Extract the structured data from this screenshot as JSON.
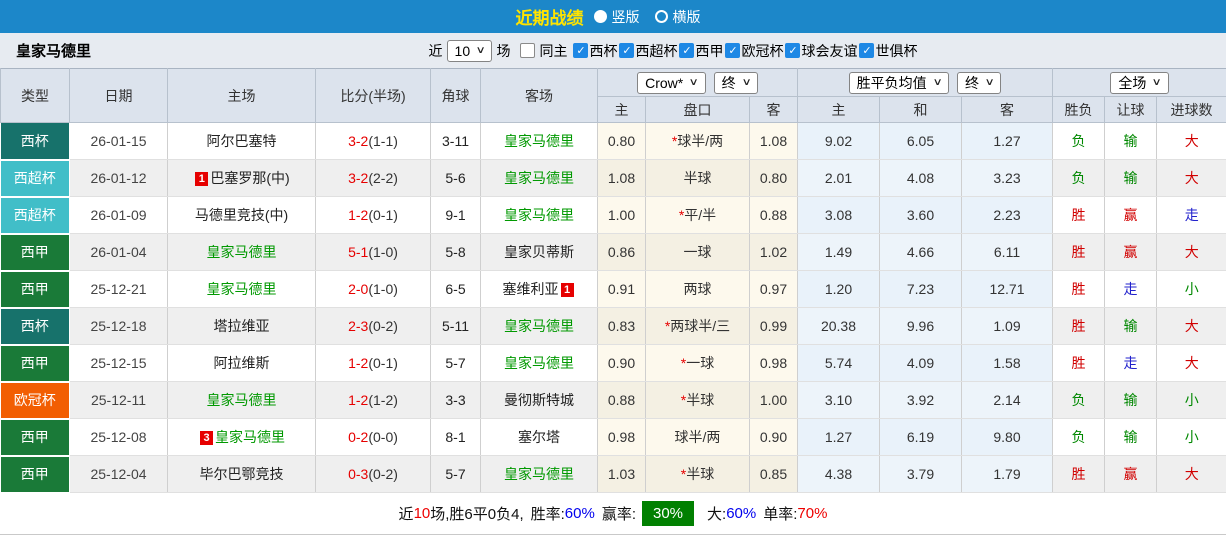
{
  "colors": {
    "topbar": "#1C87C9",
    "title": "#FFE400",
    "team_green": "#009900",
    "score_red": "#E60000",
    "badge_red": "#E60000",
    "res_red": "#D10000",
    "res_green": "#008800",
    "res_blue": "#2222CC",
    "rate_blue": "#0000EE",
    "rate_red": "#EE0000",
    "rate_green_bg": "#018001"
  },
  "titlebar": {
    "title": "近期战绩",
    "radio_vertical": "竖版",
    "radio_horizontal": "横版"
  },
  "filterbar": {
    "team": "皇家马德里",
    "recent_label": "近",
    "recent_value": "10",
    "recent_suffix": "场",
    "same_home_label": "同主",
    "competitions": [
      "西杯",
      "西超杯",
      "西甲",
      "欧冠杯",
      "球会友谊",
      "世俱杯"
    ]
  },
  "header": {
    "cols": [
      "类型",
      "日期",
      "主场",
      "比分(半场)",
      "角球",
      "客场"
    ],
    "odds_select": "Crow*",
    "odds_final_select": "终",
    "avg_select": "胜平负均值",
    "avg_final_select": "终",
    "scope_select": "全场",
    "sub": [
      "主",
      "盘口",
      "客",
      "主",
      "和",
      "客",
      "胜负",
      "让球",
      "进球数"
    ]
  },
  "rows": [
    {
      "type": "西杯",
      "type_color": "#17726B",
      "date": "26-01-15",
      "home": "阿尔巴塞特",
      "home_green": false,
      "home_badge": "",
      "score": "3-2",
      "half": "(1-1)",
      "corner": "3-11",
      "away": "皇家马德里",
      "away_green": true,
      "away_badge": "",
      "odds_home": "0.80",
      "hcp_star": "*",
      "hcp": "球半/两",
      "odds_away": "1.08",
      "avg_home": "9.02",
      "avg_draw": "6.05",
      "avg_away": "1.27",
      "res_wdl": "负",
      "wdl_color": "green",
      "res_hcp": "输",
      "hcp_color": "green",
      "res_goal": "大",
      "goal_color": "red"
    },
    {
      "type": "西超杯",
      "type_color": "#41BEC8",
      "date": "26-01-12",
      "home": "巴塞罗那(中)",
      "home_green": false,
      "home_badge": "1",
      "score": "3-2",
      "half": "(2-2)",
      "corner": "5-6",
      "away": "皇家马德里",
      "away_green": true,
      "away_badge": "",
      "odds_home": "1.08",
      "hcp_star": "",
      "hcp": "半球",
      "odds_away": "0.80",
      "avg_home": "2.01",
      "avg_draw": "4.08",
      "avg_away": "3.23",
      "res_wdl": "负",
      "wdl_color": "green",
      "res_hcp": "输",
      "hcp_color": "green",
      "res_goal": "大",
      "goal_color": "red"
    },
    {
      "type": "西超杯",
      "type_color": "#41BEC8",
      "date": "26-01-09",
      "home": "马德里竞技(中)",
      "home_green": false,
      "home_badge": "",
      "score": "1-2",
      "half": "(0-1)",
      "corner": "9-1",
      "away": "皇家马德里",
      "away_green": true,
      "away_badge": "",
      "odds_home": "1.00",
      "hcp_star": "*",
      "hcp": "平/半",
      "odds_away": "0.88",
      "avg_home": "3.08",
      "avg_draw": "3.60",
      "avg_away": "2.23",
      "res_wdl": "胜",
      "wdl_color": "red",
      "res_hcp": "赢",
      "hcp_color": "red",
      "res_goal": "走",
      "goal_color": "blue"
    },
    {
      "type": "西甲",
      "type_color": "#1A7A38",
      "date": "26-01-04",
      "home": "皇家马德里",
      "home_green": true,
      "home_badge": "",
      "score": "5-1",
      "half": "(1-0)",
      "corner": "5-8",
      "away": "皇家贝蒂斯",
      "away_green": false,
      "away_badge": "",
      "odds_home": "0.86",
      "hcp_star": "",
      "hcp": "一球",
      "odds_away": "1.02",
      "avg_home": "1.49",
      "avg_draw": "4.66",
      "avg_away": "6.11",
      "res_wdl": "胜",
      "wdl_color": "red",
      "res_hcp": "赢",
      "hcp_color": "red",
      "res_goal": "大",
      "goal_color": "red"
    },
    {
      "type": "西甲",
      "type_color": "#1A7A38",
      "date": "25-12-21",
      "home": "皇家马德里",
      "home_green": true,
      "home_badge": "",
      "score": "2-0",
      "half": "(1-0)",
      "corner": "6-5",
      "away": "塞维利亚",
      "away_green": false,
      "away_badge": "1",
      "odds_home": "0.91",
      "hcp_star": "",
      "hcp": "两球",
      "odds_away": "0.97",
      "avg_home": "1.20",
      "avg_draw": "7.23",
      "avg_away": "12.71",
      "res_wdl": "胜",
      "wdl_color": "red",
      "res_hcp": "走",
      "hcp_color": "blue",
      "res_goal": "小",
      "goal_color": "green"
    },
    {
      "type": "西杯",
      "type_color": "#17726B",
      "date": "25-12-18",
      "home": "塔拉维亚",
      "home_green": false,
      "home_badge": "",
      "score": "2-3",
      "half": "(0-2)",
      "corner": "5-11",
      "away": "皇家马德里",
      "away_green": true,
      "away_badge": "",
      "odds_home": "0.83",
      "hcp_star": "*",
      "hcp": "两球半/三",
      "odds_away": "0.99",
      "avg_home": "20.38",
      "avg_draw": "9.96",
      "avg_away": "1.09",
      "res_wdl": "胜",
      "wdl_color": "red",
      "res_hcp": "输",
      "hcp_color": "green",
      "res_goal": "大",
      "goal_color": "red"
    },
    {
      "type": "西甲",
      "type_color": "#1A7A38",
      "date": "25-12-15",
      "home": "阿拉维斯",
      "home_green": false,
      "home_badge": "",
      "score": "1-2",
      "half": "(0-1)",
      "corner": "5-7",
      "away": "皇家马德里",
      "away_green": true,
      "away_badge": "",
      "odds_home": "0.90",
      "hcp_star": "*",
      "hcp": "一球",
      "odds_away": "0.98",
      "avg_home": "5.74",
      "avg_draw": "4.09",
      "avg_away": "1.58",
      "res_wdl": "胜",
      "wdl_color": "red",
      "res_hcp": "走",
      "hcp_color": "blue",
      "res_goal": "大",
      "goal_color": "red"
    },
    {
      "type": "欧冠杯",
      "type_color": "#F25E02",
      "date": "25-12-11",
      "home": "皇家马德里",
      "home_green": true,
      "home_badge": "",
      "score": "1-2",
      "half": "(1-2)",
      "corner": "3-3",
      "away": "曼彻斯特城",
      "away_green": false,
      "away_badge": "",
      "odds_home": "0.88",
      "hcp_star": "*",
      "hcp": "半球",
      "odds_away": "1.00",
      "avg_home": "3.10",
      "avg_draw": "3.92",
      "avg_away": "2.14",
      "res_wdl": "负",
      "wdl_color": "green",
      "res_hcp": "输",
      "hcp_color": "green",
      "res_goal": "小",
      "goal_color": "green"
    },
    {
      "type": "西甲",
      "type_color": "#1A7A38",
      "date": "25-12-08",
      "home": "皇家马德里",
      "home_green": true,
      "home_badge": "3",
      "score": "0-2",
      "half": "(0-0)",
      "corner": "8-1",
      "away": "塞尔塔",
      "away_green": false,
      "away_badge": "",
      "odds_home": "0.98",
      "hcp_star": "",
      "hcp": "球半/两",
      "odds_away": "0.90",
      "avg_home": "1.27",
      "avg_draw": "6.19",
      "avg_away": "9.80",
      "res_wdl": "负",
      "wdl_color": "green",
      "res_hcp": "输",
      "hcp_color": "green",
      "res_goal": "小",
      "goal_color": "green"
    },
    {
      "type": "西甲",
      "type_color": "#1A7A38",
      "date": "25-12-04",
      "home": "毕尔巴鄂竞技",
      "home_green": false,
      "home_badge": "",
      "score": "0-3",
      "half": "(0-2)",
      "corner": "5-7",
      "away": "皇家马德里",
      "away_green": true,
      "away_badge": "",
      "odds_home": "1.03",
      "hcp_star": "*",
      "hcp": "半球",
      "odds_away": "0.85",
      "avg_home": "4.38",
      "avg_draw": "3.79",
      "avg_away": "1.79",
      "res_wdl": "胜",
      "wdl_color": "red",
      "res_hcp": "赢",
      "hcp_color": "red",
      "res_goal": "大",
      "goal_color": "red"
    }
  ],
  "summary": {
    "recent_label": "近",
    "recent_count": "10",
    "record": "场,胜6平0负4,",
    "win_rate_label": "胜率:",
    "win_rate": "60%",
    "odds_win_label": "赢率:",
    "odds_win_rate": "30%",
    "big_label": "大:",
    "big_rate": "60%",
    "single_label": "单率:",
    "single_rate": "70%"
  }
}
